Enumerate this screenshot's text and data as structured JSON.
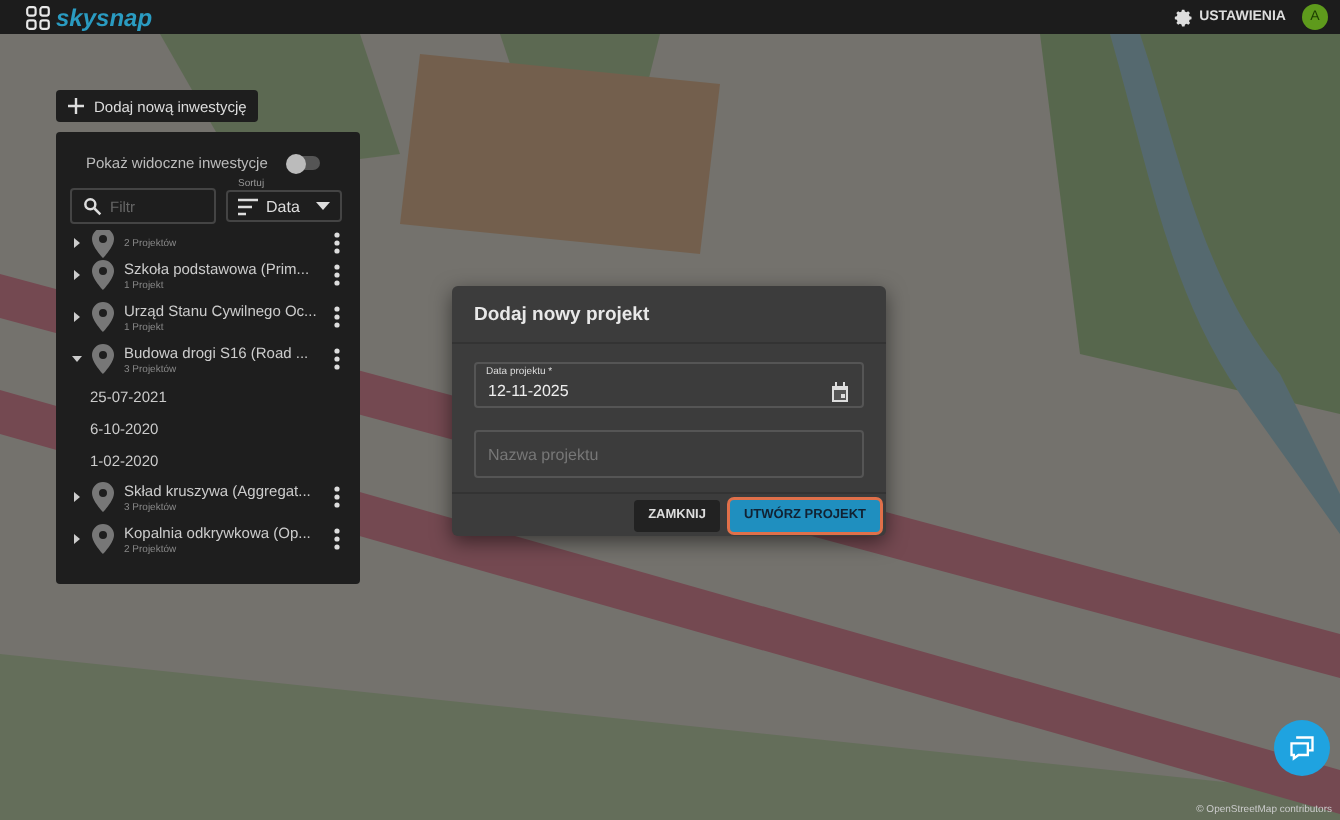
{
  "app": {
    "logo_text": "skysnap",
    "settings_label": "USTAWIENIA",
    "avatar_initial": "A"
  },
  "add_button": {
    "label": "Dodaj nową inwestycję"
  },
  "panel": {
    "toggle": {
      "label": "Pokaż widoczne inwestycje",
      "on": false
    },
    "filter": {
      "placeholder": "Filtr"
    },
    "sort": {
      "label": "Sortuj",
      "value": "Data"
    },
    "items": [
      {
        "subtitle": "2 Projektów",
        "expanded": false
      },
      {
        "title": "Szkoła podstawowa (Prim...",
        "subtitle": "1 Projekt",
        "expanded": false
      },
      {
        "title": "Urząd Stanu Cywilnego Oc...",
        "subtitle": "1 Projekt",
        "expanded": false
      },
      {
        "title": "Budowa drogi S16 (Road ...",
        "subtitle": "3 Projektów",
        "expanded": true,
        "children": [
          {
            "label": "25-07-2021"
          },
          {
            "label": "6-10-2020"
          },
          {
            "label": "1-02-2020"
          }
        ]
      },
      {
        "title": "Skład kruszywa (Aggregat...",
        "subtitle": "3 Projektów",
        "expanded": false
      },
      {
        "title": "Kopalnia odkrywkowa (Op...",
        "subtitle": "2 Projektów",
        "expanded": false
      }
    ]
  },
  "dialog": {
    "title": "Dodaj nowy projekt",
    "date_field": {
      "label": "Data projektu *",
      "value": "12-11-2025"
    },
    "name_field": {
      "placeholder": "Nazwa projektu"
    },
    "buttons": [
      {
        "label": "ZAMKNIJ",
        "kind": "secondary"
      },
      {
        "label": "UTWÓRZ PROJEKT",
        "kind": "primary"
      }
    ]
  },
  "attribution": "© OpenStreetMap contributors"
}
